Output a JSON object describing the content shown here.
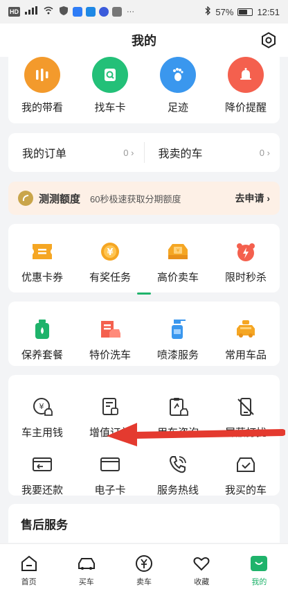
{
  "status": {
    "left_icons": [
      "HD",
      "4G",
      "wifi",
      "vpn",
      "app-blue",
      "app-q",
      "app-music",
      "app-grey",
      "···"
    ],
    "battery": "57%",
    "time": "12:51"
  },
  "header": {
    "title": "我的"
  },
  "quick": [
    {
      "label": "我的带看",
      "color": "#f39a2c",
      "icon": "bars-icon"
    },
    {
      "label": "找车卡",
      "color": "#23c078",
      "icon": "card-search-icon"
    },
    {
      "label": "足迹",
      "color": "#3a97ee",
      "icon": "footprint-icon"
    },
    {
      "label": "降价提醒",
      "color": "#f4604e",
      "icon": "bell-icon"
    }
  ],
  "orders": [
    {
      "label": "我的订单",
      "count": "0"
    },
    {
      "label": "我卖的车",
      "count": "0"
    }
  ],
  "credit": {
    "title": "测测额度",
    "desc": "60秒极速获取分期额度",
    "apply": "去申请"
  },
  "grid1": [
    {
      "label": "优惠卡券",
      "icon": "coupon-icon"
    },
    {
      "label": "有奖任务",
      "icon": "coin-icon"
    },
    {
      "label": "高价卖车",
      "icon": "sell-car-icon"
    },
    {
      "label": "限时秒杀",
      "icon": "flash-sale-icon"
    }
  ],
  "grid2": [
    {
      "label": "保养套餐",
      "icon": "oil-icon"
    },
    {
      "label": "特价洗车",
      "icon": "car-wash-icon"
    },
    {
      "label": "喷漆服务",
      "icon": "spray-icon"
    },
    {
      "label": "常用车品",
      "icon": "car-goods-icon"
    }
  ],
  "grid3": [
    {
      "label": "车主用钱",
      "icon": "money-car-icon"
    },
    {
      "label": "增值订单",
      "icon": "order-doc-icon"
    },
    {
      "label": "用车咨询",
      "icon": "consult-icon"
    },
    {
      "label": "屏蔽打扰",
      "icon": "block-phone-icon"
    },
    {
      "label": "我要还款",
      "icon": "repay-card-icon"
    },
    {
      "label": "电子卡",
      "icon": "e-card-icon"
    },
    {
      "label": "服务热线",
      "icon": "hotline-icon"
    },
    {
      "label": "我买的车",
      "icon": "bought-car-icon"
    }
  ],
  "after_sales": {
    "title": "售后服务"
  },
  "tabs": [
    {
      "label": "首页",
      "icon": "home-icon"
    },
    {
      "label": "买车",
      "icon": "car-icon"
    },
    {
      "label": "卖车",
      "icon": "yen-icon"
    },
    {
      "label": "收藏",
      "icon": "heart-icon"
    },
    {
      "label": "我的",
      "icon": "profile-icon"
    }
  ],
  "colors": {
    "brand": "#1fb36b",
    "annotation_arrow": "#e43a2f"
  }
}
